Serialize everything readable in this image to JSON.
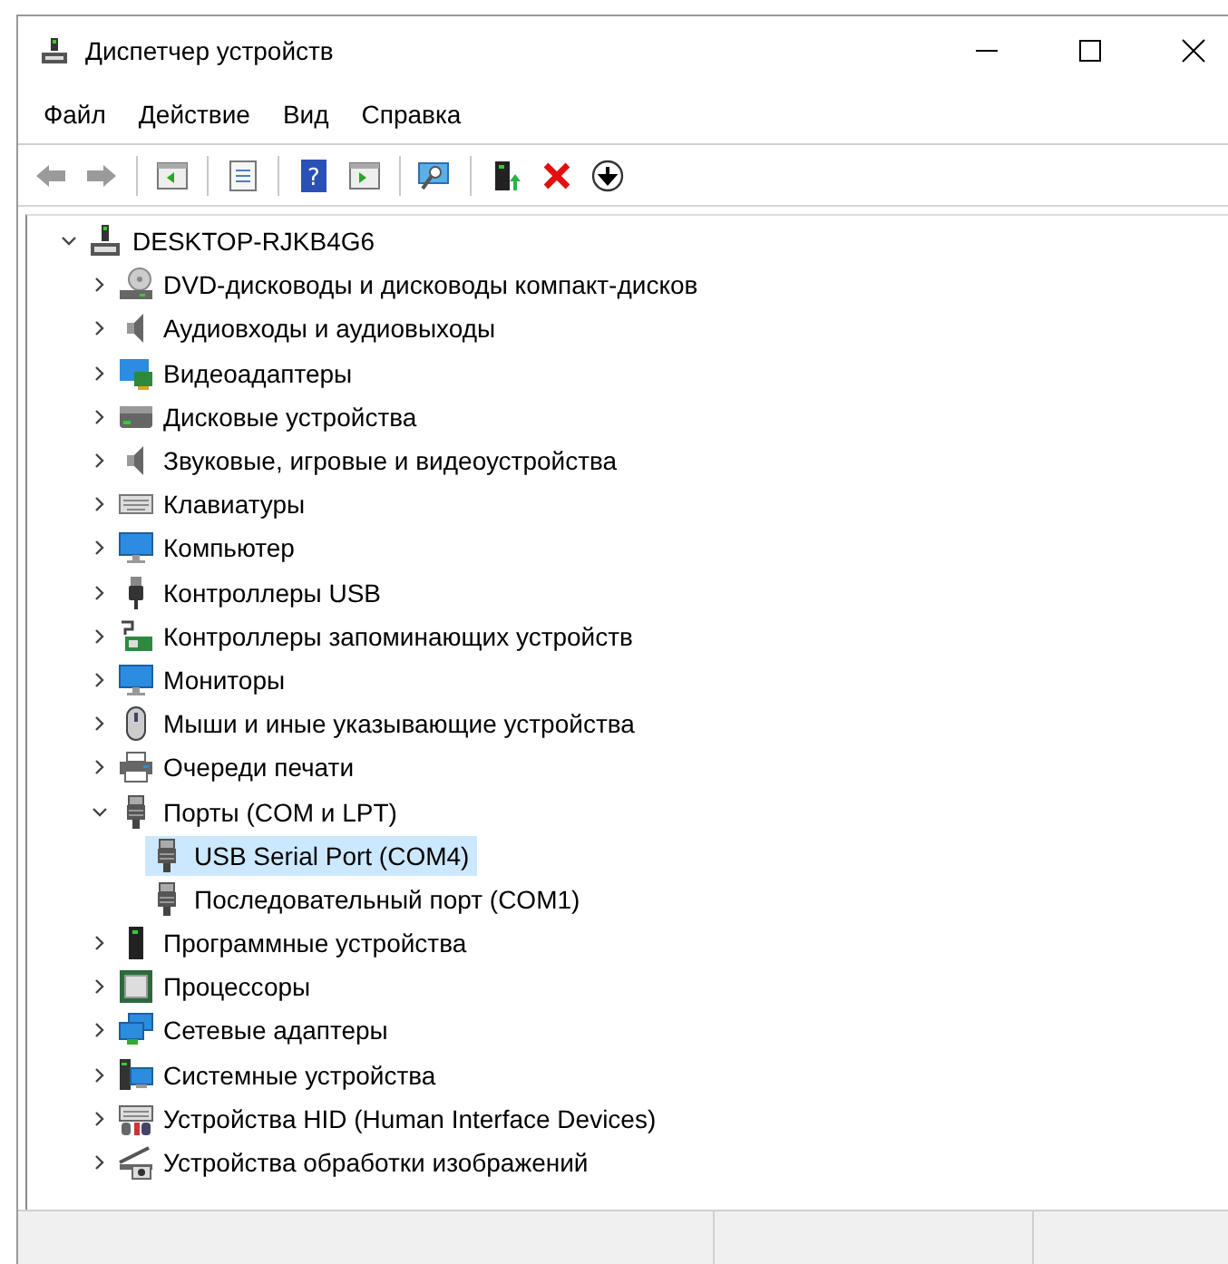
{
  "window": {
    "title": "Диспетчер устройств"
  },
  "menu": [
    "Файл",
    "Действие",
    "Вид",
    "Справка"
  ],
  "toolbar": [
    {
      "kind": "back",
      "disabled": true
    },
    {
      "kind": "forward",
      "disabled": true
    },
    {
      "kind": "separator"
    },
    {
      "kind": "pane"
    },
    {
      "kind": "separator"
    },
    {
      "kind": "properties"
    },
    {
      "kind": "separator"
    },
    {
      "kind": "help",
      "label": "?"
    },
    {
      "kind": "pane2"
    },
    {
      "kind": "separator"
    },
    {
      "kind": "scan"
    },
    {
      "kind": "separator"
    },
    {
      "kind": "update"
    },
    {
      "kind": "remove"
    },
    {
      "kind": "download"
    }
  ],
  "tree": [
    {
      "label": "DESKTOP-RJKB4G6",
      "kind": "computer",
      "expanded": true,
      "selected": false,
      "children": [
        {
          "label": "DVD-дисководы и дисководы компакт-дисков",
          "kind": "dvd",
          "expanded": false,
          "selected": false
        },
        {
          "label": "Аудиовходы и аудиовыходы",
          "kind": "speaker",
          "expanded": false,
          "selected": false
        },
        {
          "label": "Видеоадаптеры",
          "kind": "video",
          "expanded": false,
          "selected": false
        },
        {
          "label": "Дисковые устройства",
          "kind": "disk",
          "expanded": false,
          "selected": false
        },
        {
          "label": "Звуковые, игровые и видеоустройства",
          "kind": "speaker",
          "expanded": false,
          "selected": false
        },
        {
          "label": "Клавиатуры",
          "kind": "keyboard",
          "expanded": false,
          "selected": false
        },
        {
          "label": "Компьютер",
          "kind": "monitor",
          "expanded": false,
          "selected": false
        },
        {
          "label": "Контроллеры USB",
          "kind": "usb",
          "expanded": false,
          "selected": false
        },
        {
          "label": "Контроллеры запоминающих устройств",
          "kind": "storage",
          "expanded": false,
          "selected": false
        },
        {
          "label": "Мониторы",
          "kind": "monitor",
          "expanded": false,
          "selected": false
        },
        {
          "label": "Мыши и иные указывающие устройства",
          "kind": "mouse",
          "expanded": false,
          "selected": false
        },
        {
          "label": "Очереди печати",
          "kind": "printer",
          "expanded": false,
          "selected": false
        },
        {
          "label": "Порты (COM и LPT)",
          "kind": "port",
          "expanded": true,
          "selected": false,
          "children": [
            {
              "label": "USB Serial Port (COM4)",
              "kind": "port",
              "selected": true
            },
            {
              "label": "Последовательный порт (COM1)",
              "kind": "port",
              "selected": false
            }
          ]
        },
        {
          "label": "Программные устройства",
          "kind": "firmware",
          "expanded": false,
          "selected": false
        },
        {
          "label": "Процессоры",
          "kind": "cpu",
          "expanded": false,
          "selected": false
        },
        {
          "label": "Сетевые адаптеры",
          "kind": "network",
          "expanded": false,
          "selected": false
        },
        {
          "label": "Системные устройства",
          "kind": "system",
          "expanded": false,
          "selected": false
        },
        {
          "label": "Устройства HID (Human Interface Devices)",
          "kind": "hid",
          "expanded": false,
          "selected": false
        },
        {
          "label": "Устройства обработки изображений",
          "kind": "camera",
          "expanded": false,
          "selected": false
        }
      ]
    }
  ]
}
